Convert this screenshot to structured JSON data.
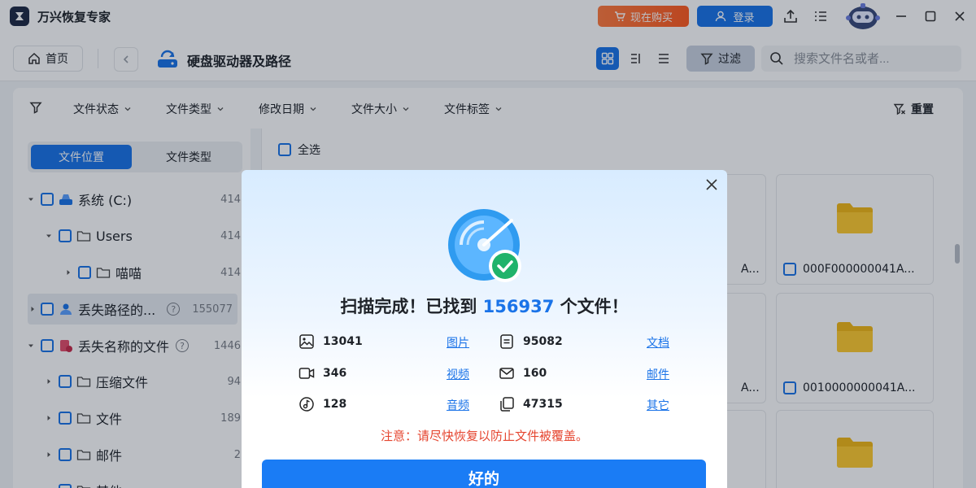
{
  "app": {
    "title": "万兴恢复专家"
  },
  "titlebar": {
    "buy_label": "现在购买",
    "login_label": "登录"
  },
  "toolbar": {
    "home_label": "首页",
    "location_title": "硬盘驱动器及路径",
    "filter_label": "过滤",
    "search_placeholder": "搜索文件名或者..."
  },
  "filters": {
    "items": [
      "文件状态",
      "文件类型",
      "修改日期",
      "文件大小",
      "文件标签"
    ],
    "reset_label": "重置"
  },
  "sidebar": {
    "tabs": [
      "文件位置",
      "文件类型"
    ],
    "tree": [
      {
        "label": "系统 (C:)",
        "count": "414"
      },
      {
        "label": "Users",
        "count": "414"
      },
      {
        "label": "喵喵",
        "count": "414"
      },
      {
        "label": "丢失路径的...",
        "count": "155077"
      },
      {
        "label": "丢失名称的文件",
        "count": "1446"
      },
      {
        "label": "压缩文件",
        "count": "94"
      },
      {
        "label": "文件",
        "count": "189"
      },
      {
        "label": "邮件",
        "count": "2"
      },
      {
        "label": "其他",
        "count": ""
      }
    ]
  },
  "content": {
    "select_all_label": "全选",
    "cards": [
      {
        "name": "000F000000041A..."
      },
      {
        "name": "0010000000041A..."
      },
      {
        "name": ""
      }
    ],
    "partial_names": [
      "A...",
      "A..."
    ]
  },
  "modal": {
    "title_prefix": "扫描完成！已找到",
    "title_count": "156937",
    "title_suffix": "个文件！",
    "stats": [
      {
        "icon": "image-icon",
        "count": "13041",
        "link": "图片"
      },
      {
        "icon": "document-icon",
        "count": "95082",
        "link": "文档"
      },
      {
        "icon": "video-icon",
        "count": "346",
        "link": "视频"
      },
      {
        "icon": "mail-icon",
        "count": "160",
        "link": "邮件"
      },
      {
        "icon": "audio-icon",
        "count": "128",
        "link": "音频"
      },
      {
        "icon": "other-files-icon",
        "count": "47315",
        "link": "其它"
      }
    ],
    "warning": "注意：请尽快恢复以防止文件被覆盖。",
    "ok_label": "好的"
  },
  "colors": {
    "accent": "#1a73e8",
    "buy": "#ff6a2a",
    "warning": "#e5452f"
  }
}
